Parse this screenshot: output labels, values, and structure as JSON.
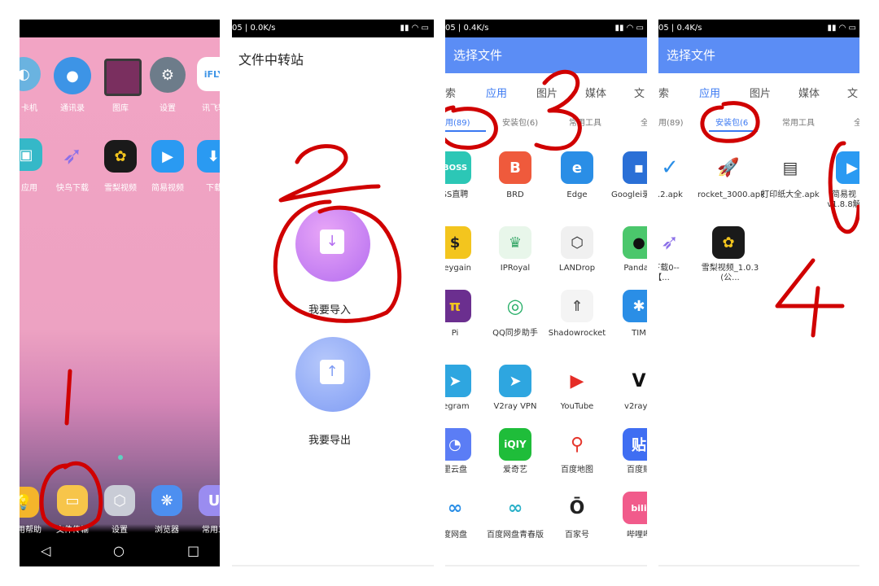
{
  "panel1": {
    "row1": [
      "卡机",
      "通讯录",
      "图库",
      "设置",
      "讯飞输"
    ],
    "row2": [
      "应用",
      "快鸟下载",
      "雪梨视频",
      "简易视频",
      "下载"
    ],
    "dock": [
      "用帮助",
      "文件传输",
      "设置",
      "浏览器",
      "常用工"
    ],
    "annotation": "1"
  },
  "panel2": {
    "status": "05 | 0.0K/s",
    "title": "文件中转站",
    "import_label": "我要导入",
    "export_label": "我要导出",
    "annotation": "2"
  },
  "panel3": {
    "status": "05 | 0.4K/s",
    "title": "选择文件",
    "tabs": [
      "索",
      "应用",
      "图片",
      "媒体",
      "文"
    ],
    "subtabs": [
      "用(89)",
      "安装包(6)",
      "常用工具",
      "全"
    ],
    "apps": [
      [
        "SS直聘",
        "BRD",
        "Edge",
        "Googlei录同步"
      ],
      [
        "neygain",
        "IPRoyal",
        "LANDrop",
        "PandaV"
      ],
      [
        "Pi",
        "QQ同步助手",
        "Shadowrocket",
        "TIM"
      ],
      [
        "legram",
        "V2ray VPN",
        "YouTube",
        "v2rayN"
      ],
      [
        "里云盘",
        "爱奇艺",
        "百度地图",
        "百度贴"
      ],
      [
        "度网盘",
        "百度网盘青春版",
        "百家号",
        "哔哩哔"
      ]
    ],
    "annotation": "3"
  },
  "panel4": {
    "status": "05 | 0.4K/s",
    "title": "选择文件",
    "tabs": [
      "索",
      "应用",
      "图片",
      "媒体",
      "文"
    ],
    "subtabs": [
      "用(89)",
      "安装包(6",
      "常用工具",
      "全"
    ],
    "files": [
      "_2.3.2.apk",
      "rocket_3000.apk",
      "打印纸大全.apk",
      "简易视v1.8.8解"
    ],
    "files2": [
      "鸟下载0--【...",
      "雪梨视频_1.0.3 (公..."
    ],
    "annotation": "4"
  },
  "colors": {
    "accent": "#5b8df5",
    "annotation": "#d00000"
  }
}
